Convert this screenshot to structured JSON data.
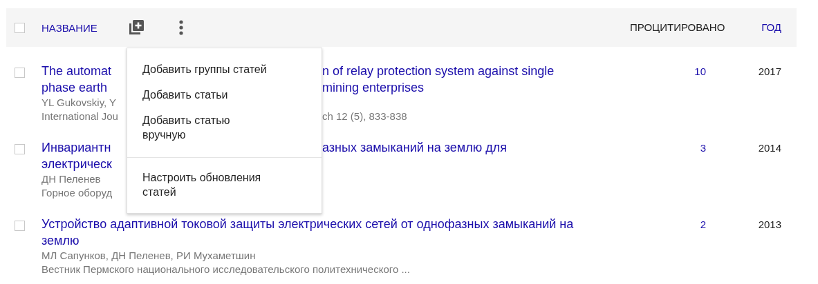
{
  "header": {
    "select_all": {
      "checked": false
    },
    "columns": [
      {
        "label": "НАЗВАНИЕ",
        "selected": false
      },
      {
        "label": "ПРОЦИТИРОВАНО",
        "selected": true
      },
      {
        "label": "ГОД",
        "selected": false
      }
    ]
  },
  "articles": [
    {
      "kind": "covered",
      "checked": false,
      "title_lines": [
        [
          "The automat",
          "n of relay protection system against single"
        ],
        [
          "phase earth",
          "mining enterprises"
        ]
      ],
      "authors": [
        "YL Gukovskiy, Y"
      ],
      "source": [
        "International Jou",
        "ch 12 (5), 833-838"
      ],
      "cited": "10",
      "year": "2017"
    },
    {
      "kind": "covered",
      "checked": false,
      "title_lines": [
        [
          "Инвариантн",
          "азных замыканий на землю для"
        ],
        [
          "электрическ"
        ]
      ],
      "authors": [
        "ДН Пеленев"
      ],
      "source": [
        "Горное оборуд"
      ],
      "cited": "3",
      "year": "2014"
    },
    {
      "kind": "full",
      "checked": false,
      "title": "Устройство адаптивной токовой защиты электрических сетей от однофазных замыканий на землю",
      "authors": "МЛ Сапунков, ДН Пеленев, РИ Мухаметшин",
      "source": "Вестник Пермского национального исследовательского политехнического ...",
      "cited": "2",
      "year": "2013"
    }
  ],
  "menu": {
    "groups": [
      [
        "Добавить группы статей",
        "Добавить статьи",
        "Добавить статью вручную"
      ],
      [
        "Настроить обновления статей"
      ]
    ]
  }
}
